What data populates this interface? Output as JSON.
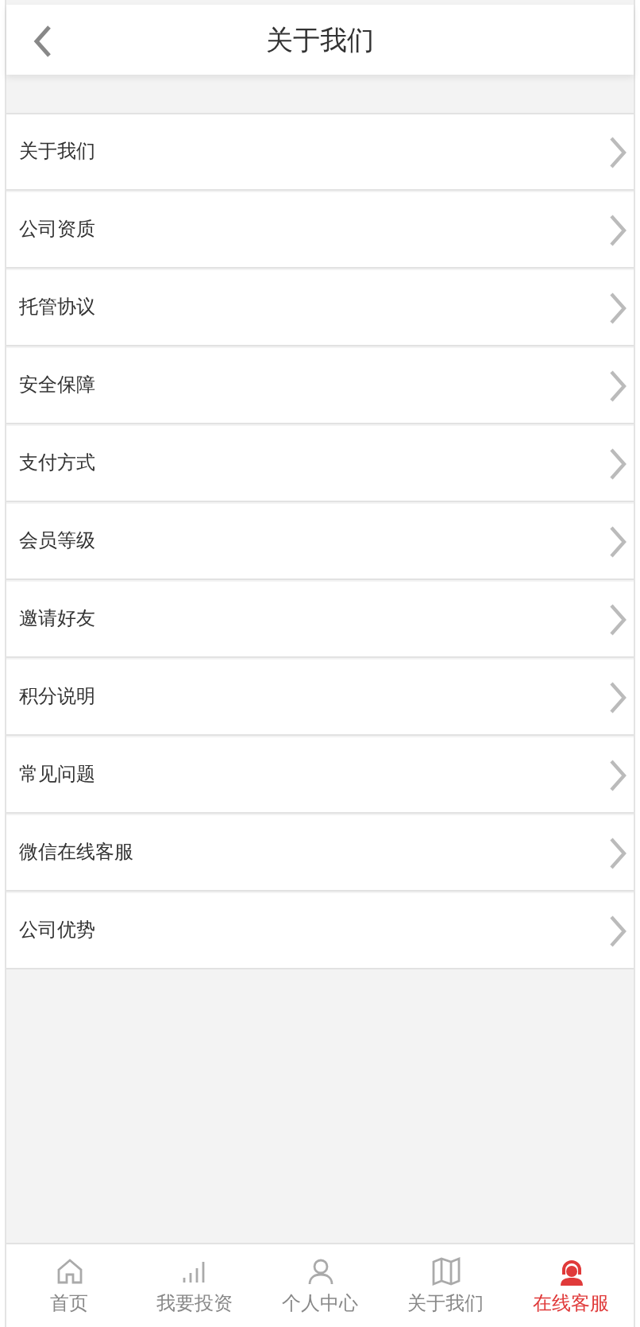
{
  "header": {
    "title": "关于我们"
  },
  "menu": [
    {
      "label": "关于我们"
    },
    {
      "label": "公司资质"
    },
    {
      "label": "托管协议"
    },
    {
      "label": "安全保障"
    },
    {
      "label": "支付方式"
    },
    {
      "label": "会员等级"
    },
    {
      "label": "邀请好友"
    },
    {
      "label": "积分说明"
    },
    {
      "label": "常见问题"
    },
    {
      "label": "微信在线客服"
    },
    {
      "label": "公司优势"
    }
  ],
  "tabs": [
    {
      "label": "首页",
      "kind": "home",
      "selected": false
    },
    {
      "label": "我要投资",
      "kind": "invest",
      "selected": false
    },
    {
      "label": "个人中心",
      "kind": "user",
      "selected": false
    },
    {
      "label": "关于我们",
      "kind": "about",
      "selected": false
    },
    {
      "label": "在线客服",
      "kind": "service",
      "selected": true
    }
  ]
}
